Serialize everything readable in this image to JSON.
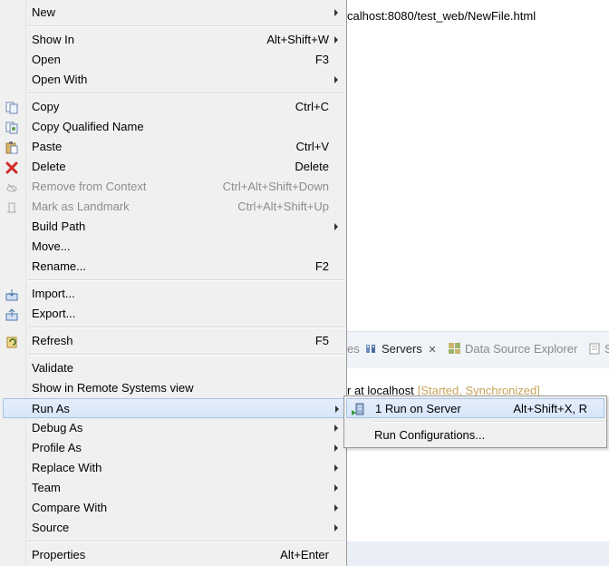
{
  "background": {
    "url_text": "calhost:8080/test_web/NewFile.html",
    "tabs": [
      {
        "label": "es",
        "icon": "",
        "dim": true
      },
      {
        "label": "Servers",
        "icon": "servers-icon",
        "dim": false,
        "close": "✕"
      },
      {
        "label": "Data Source Explorer",
        "icon": "data-source-icon",
        "dim": true
      },
      {
        "label": "S",
        "icon": "snippets-icon",
        "dim": true
      }
    ],
    "server_line": "r at localhost",
    "server_status": "[Started, Synchronized]"
  },
  "menu": {
    "items": [
      {
        "label": "New",
        "shortcut": "",
        "submenu": true
      },
      {
        "label": "Show In",
        "shortcut": "Alt+Shift+W",
        "submenu": true
      },
      {
        "label": "Open",
        "shortcut": "F3"
      },
      {
        "label": "Open With",
        "shortcut": "",
        "submenu": true
      },
      {
        "label": "Copy",
        "shortcut": "Ctrl+C",
        "icon": "copy-icon"
      },
      {
        "label": "Copy Qualified Name",
        "shortcut": "",
        "icon": "copy-qualified-icon"
      },
      {
        "label": "Paste",
        "shortcut": "Ctrl+V",
        "icon": "paste-icon"
      },
      {
        "label": "Delete",
        "shortcut": "Delete",
        "icon": "delete-icon"
      },
      {
        "label": "Remove from Context",
        "shortcut": "Ctrl+Alt+Shift+Down",
        "icon": "remove-context-icon",
        "disabled": true
      },
      {
        "label": "Mark as Landmark",
        "shortcut": "Ctrl+Alt+Shift+Up",
        "icon": "landmark-icon",
        "disabled": true
      },
      {
        "label": "Build Path",
        "shortcut": "",
        "submenu": true
      },
      {
        "label": "Move...",
        "shortcut": ""
      },
      {
        "label": "Rename...",
        "shortcut": "F2"
      },
      {
        "label": "Import...",
        "shortcut": "",
        "icon": "import-icon"
      },
      {
        "label": "Export...",
        "shortcut": "",
        "icon": "export-icon"
      },
      {
        "label": "Refresh",
        "shortcut": "F5",
        "icon": "refresh-icon"
      },
      {
        "label": "Validate",
        "shortcut": ""
      },
      {
        "label": "Show in Remote Systems view",
        "shortcut": ""
      },
      {
        "label": "Run As",
        "shortcut": "",
        "submenu": true,
        "highlighted": true
      },
      {
        "label": "Debug As",
        "shortcut": "",
        "submenu": true
      },
      {
        "label": "Profile As",
        "shortcut": "",
        "submenu": true
      },
      {
        "label": "Replace With",
        "shortcut": "",
        "submenu": true
      },
      {
        "label": "Team",
        "shortcut": "",
        "submenu": true
      },
      {
        "label": "Compare With",
        "shortcut": "",
        "submenu": true
      },
      {
        "label": "Source",
        "shortcut": "",
        "submenu": true
      },
      {
        "label": "Properties",
        "shortcut": "Alt+Enter"
      }
    ]
  },
  "submenu": {
    "items": [
      {
        "label": "1 Run on Server",
        "shortcut": "Alt+Shift+X, R",
        "icon": "run-on-server-icon",
        "highlighted": true
      },
      {
        "label": "Run Configurations...",
        "shortcut": ""
      }
    ]
  },
  "colors": {
    "menu_bg": "#f0f0f0",
    "highlight": "#d6e6fa",
    "disabled_text": "#8d8d8d",
    "status_text": "#c8a45a"
  }
}
